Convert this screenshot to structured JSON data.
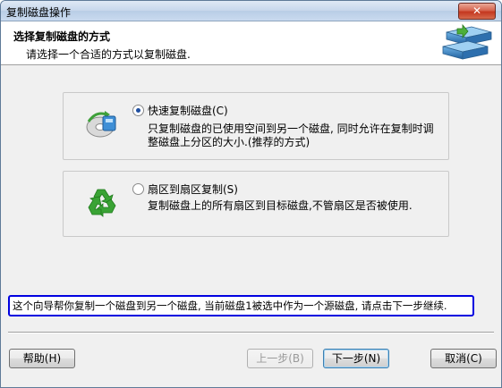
{
  "window": {
    "title": "复制磁盘操作",
    "close_label": "✕"
  },
  "header": {
    "title": "选择复制磁盘的方式",
    "subtitle": "请选择一个合适的方式以复制磁盘."
  },
  "options": [
    {
      "label": "快速复制磁盘(C)",
      "selected": true,
      "description": "只复制磁盘的已使用空间到另一个磁盘, 同时允许在复制时调整磁盘上分区的大小.(推荐的方式)",
      "icon": "fast-copy-disk-icon"
    },
    {
      "label": "扇区到扇区复制(S)",
      "selected": false,
      "description": "复制磁盘上的所有扇区到目标磁盘,不管扇区是否被使用.",
      "icon": "recycle-icon"
    }
  ],
  "status": "这个向导帮你复制一个磁盘到另一个磁盘, 当前磁盘1被选中作为一个源磁盘, 请点击下一步继续.",
  "buttons": {
    "help": "帮助(H)",
    "prev": "上一步(B)",
    "next": "下一步(N)",
    "cancel": "取消(C)"
  }
}
